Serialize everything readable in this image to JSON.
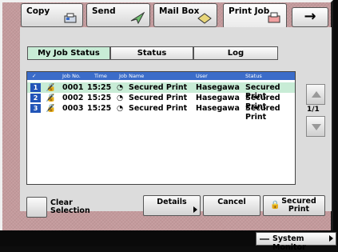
{
  "tabs": {
    "copy": "Copy",
    "send": "Send",
    "mailbox": "Mail Box",
    "printjob": "Print Job",
    "next_icon": "right-arrow-icon"
  },
  "subtabs": {
    "my_job_status": "My Job Status",
    "status": "Status",
    "log": "Log"
  },
  "table": {
    "headers": {
      "check": "✓",
      "job_no": "Job No.",
      "time": "Time",
      "job_name": "Job Name",
      "user": "User",
      "status": "Status"
    },
    "rows": [
      {
        "index": "1",
        "job_no": "0001",
        "time": "15:25",
        "job_name": "Secured Print",
        "user": "Hasegawa",
        "status": "Secured Print"
      },
      {
        "index": "2",
        "job_no": "0002",
        "time": "15:25",
        "job_name": "Secured Print",
        "user": "Hasegawa",
        "status": "Secured Print"
      },
      {
        "index": "3",
        "job_no": "0003",
        "time": "15:25",
        "job_name": "Secured Print",
        "user": "Hasegawa",
        "status": "Secured Print"
      }
    ]
  },
  "pagination": "1/1",
  "buttons": {
    "clear_selection": "Clear Selection",
    "details": "Details",
    "cancel": "Cancel",
    "secured_print": "Secured Print"
  },
  "system_monitor": "System Monitor",
  "colors": {
    "background": "#c49a9c",
    "header_blue": "#3b6cc9",
    "selected_row": "#c8ecd6",
    "index_badge": "#2255b8"
  }
}
